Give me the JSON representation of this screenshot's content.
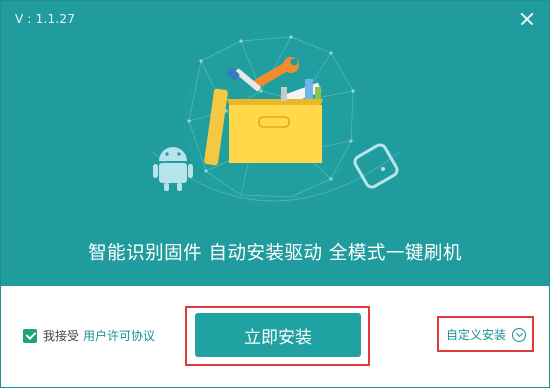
{
  "header": {
    "version": "V : 1.1.27"
  },
  "hero": {
    "tagline": "智能识别固件 自动安装驱动 全模式一键刷机",
    "illustration_icons": [
      "toolbox-icon",
      "android-robot-icon",
      "phone-device-icon",
      "wrench-icon",
      "screwdriver-icon",
      "ruler-icon"
    ]
  },
  "footer": {
    "agree_label": "我接受",
    "agree_link": "用户许可协议",
    "agree_checked": true,
    "install_label": "立即安装",
    "custom_label": "自定义安装"
  },
  "colors": {
    "hero_bg": "#209c9e",
    "accent": "#20a2a3",
    "checkbox": "#1fa37a",
    "highlight_border": "#e03a3a",
    "toolbox": "#ffd94a"
  }
}
